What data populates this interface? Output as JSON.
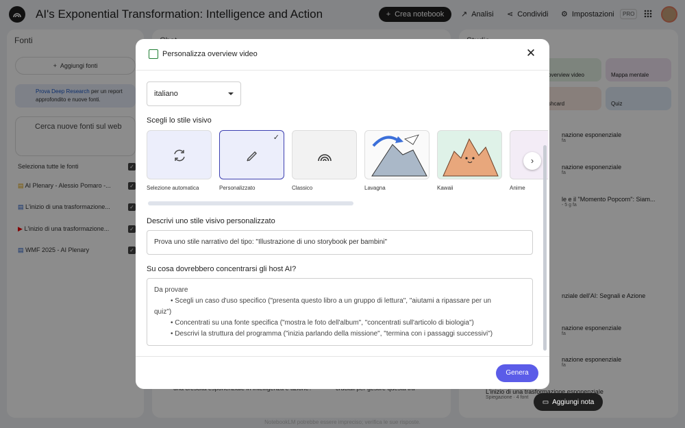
{
  "app": {
    "title": "AI's Exponential Transformation: Intelligence and Action",
    "create_notebook": "Crea notebook",
    "analytics": "Analisi",
    "share": "Condividi",
    "settings": "Impostazioni",
    "pro_badge": "PRO"
  },
  "sources": {
    "header": "Fonti",
    "add": "Aggiungi fonti",
    "deep_research_link": "Prova Deep Research",
    "deep_research_text": " per un report approfondito e nuove fonti.",
    "search_placeholder": "Cerca nuove fonti sul web",
    "select_all": "Seleziona tutte le fonti",
    "items": [
      {
        "label": "AI Plenary - Alessio Pomaro -..."
      },
      {
        "label": "L'inizio di una trasformazione..."
      },
      {
        "label": "L'inizio di una trasformazione..."
      },
      {
        "label": "WMF 2025 - AI Plenary"
      }
    ]
  },
  "chat": {
    "header": "Chat",
    "suggestions": [
      "una crescita esponenziale in intelligenza e azione?",
      "cruciali per gestire questa tra"
    ]
  },
  "studio": {
    "header": "Studio",
    "tiles": [
      "overview video",
      "Mappa mentale",
      "shcard",
      "Quiz"
    ],
    "items": [
      {
        "title": "nazione esponenziale",
        "meta": "fa"
      },
      {
        "title": "nazione esponenziale",
        "meta": "fa"
      },
      {
        "title": "le e il \"Momento Popcorn\": Siam...",
        "meta": "- 5 g fa"
      },
      {
        "title": "nziale dell'AI: Segnali e Azione",
        "meta": ""
      },
      {
        "title": "nazione esponenziale",
        "meta": "fa"
      },
      {
        "title": "nazione esponenziale",
        "meta": "fa"
      },
      {
        "title": "L'inizio di una trasformazione esponenziale",
        "meta": "Spiegazione · 4 font"
      }
    ],
    "add_note": "Aggiungi nota"
  },
  "modal": {
    "title": "Personalizza overview video",
    "language": "italiano",
    "style_label": "Scegli lo stile visivo",
    "styles": [
      {
        "name": "Selezione automatica",
        "selected": false
      },
      {
        "name": "Personalizzato",
        "selected": true
      },
      {
        "name": "Classico",
        "selected": false
      },
      {
        "name": "Lavagna",
        "selected": false
      },
      {
        "name": "Kawaii",
        "selected": false
      },
      {
        "name": "Anime",
        "selected": false
      }
    ],
    "custom_style_label": "Descrivi uno stile visivo personalizzato",
    "custom_style_placeholder": "Prova uno stile narrativo del tipo: \"Illustrazione di uno storybook per bambini\"",
    "focus_label": "Su cosa dovrebbero concentrarsi gli host AI?",
    "focus_lines": [
      "Da provare",
      "• Scegli un caso d'uso specifico (\"presenta questo libro a un gruppo di lettura\", \"aiutami a ripassare per un",
      "quiz\")",
      "• Concentrati su una fonte specifica (\"mostra le foto dell'album\", \"concentrati sull'articolo di biologia\")",
      "• Descrivi la struttura del programma (\"inizia parlando della missione\", \"termina con i passaggi successivi\")"
    ],
    "generate": "Genera"
  },
  "footer": "NotebookLM potrebbe essere impreciso; verifica le sue risposte.",
  "colors": {
    "accent": "#5b5ce8",
    "selected_border": "#3c3fb0",
    "selected_bg": "#eceefb"
  }
}
